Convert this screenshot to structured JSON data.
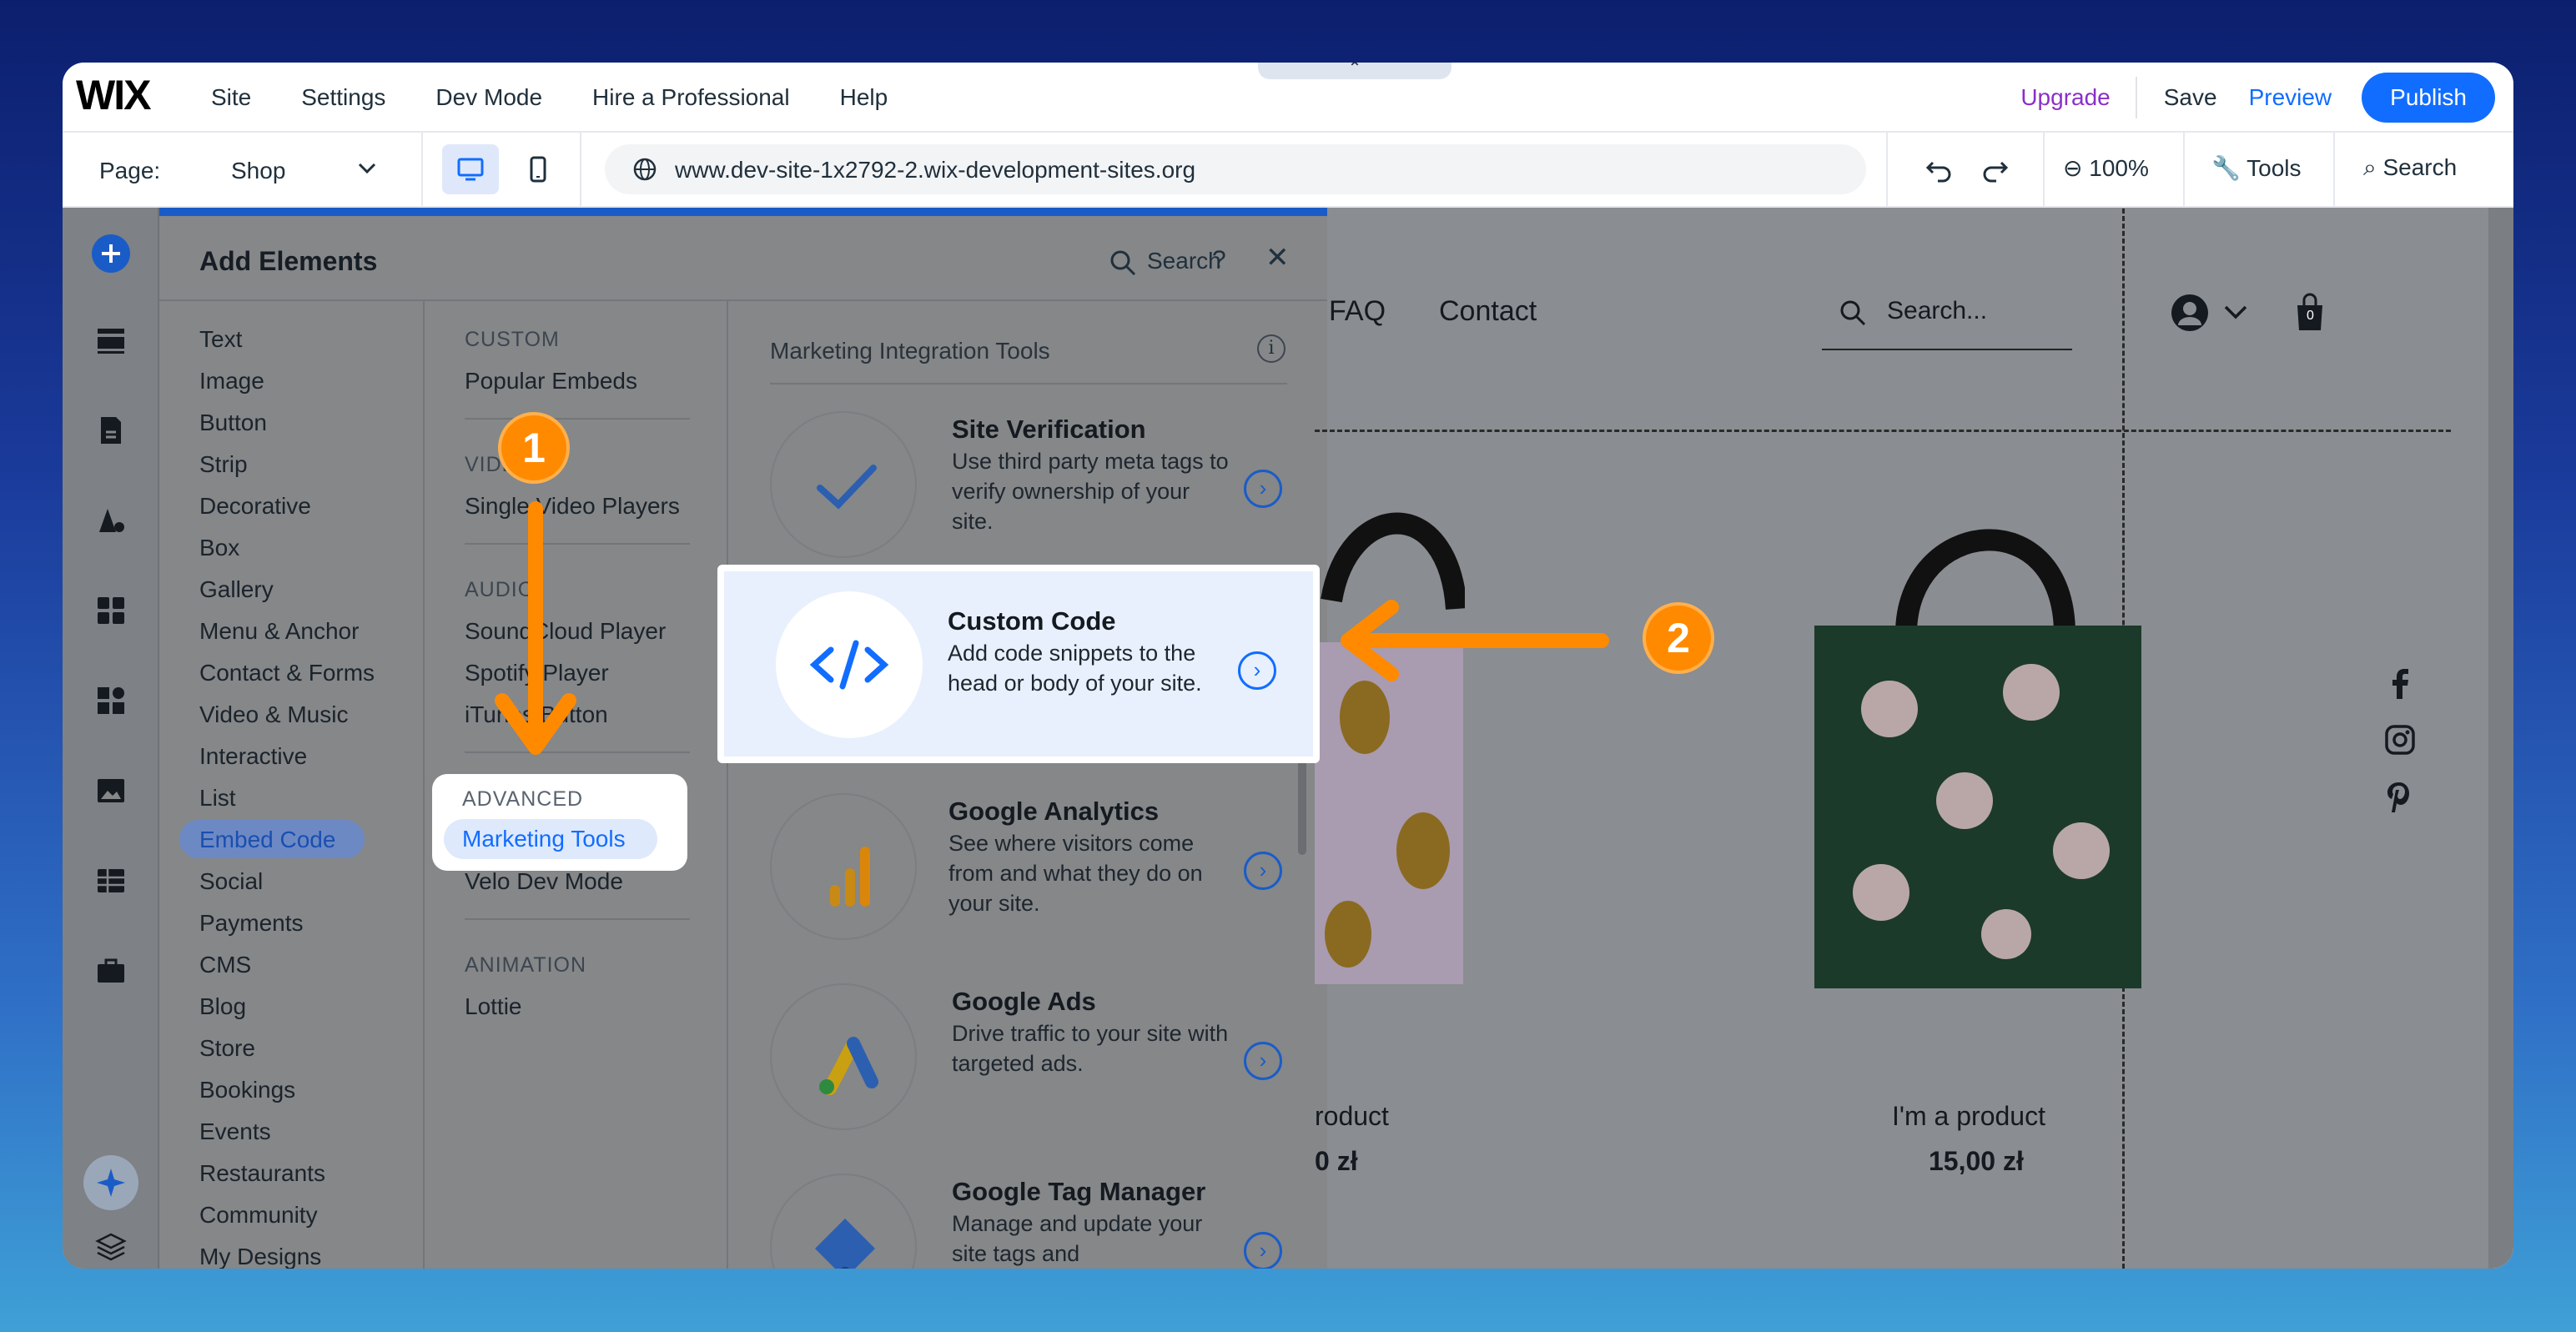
{
  "app": {
    "logo": "WIX"
  },
  "menu": [
    "Site",
    "Settings",
    "Dev Mode",
    "Hire a Professional",
    "Help"
  ],
  "topbar_right": {
    "upgrade": "Upgrade",
    "save": "Save",
    "preview": "Preview",
    "publish": "Publish"
  },
  "urlbar": {
    "page_label": "Page:",
    "page_value": "Shop",
    "url": "www.dev-site-1x2792-2.wix-development-sites.org",
    "zoom": "100%",
    "tools": "Tools",
    "search": "Search"
  },
  "panel": {
    "title": "Add Elements",
    "search": "Search",
    "help": "?",
    "categories": [
      "Text",
      "Image",
      "Button",
      "Strip",
      "Decorative",
      "Box",
      "Gallery",
      "Menu & Anchor",
      "Contact & Forms",
      "Video & Music",
      "Interactive",
      "List",
      "Embed Code",
      "Social",
      "Payments",
      "CMS",
      "Blog",
      "Store",
      "Bookings",
      "Events",
      "Restaurants",
      "Community",
      "My Designs"
    ],
    "selected_category": "Embed Code",
    "subsections": {
      "custom_header": "CUSTOM",
      "custom_item": "Popular Embeds",
      "video_header": "VIDEO",
      "video_item": "Single Video Players",
      "audio_header": "AUDIO",
      "audio_items": [
        "SoundCloud Player",
        "Spotify Player",
        "iTunes Button"
      ],
      "advanced_header": "ADVANCED",
      "advanced_items": [
        "Marketing Tools",
        "Velo Dev Mode"
      ],
      "animation_header": "ANIMATION",
      "animation_item": "Lottie"
    },
    "tools_header": "Marketing Integration Tools",
    "tools": [
      {
        "title": "Site Verification",
        "desc": "Use third party meta tags to verify ownership of your site."
      },
      {
        "title": "Custom Code",
        "desc": "Add code snippets to the head or body of your site."
      },
      {
        "title": "Google Analytics",
        "desc": "See where visitors come from and what they do on your site."
      },
      {
        "title": "Google Ads",
        "desc": "Drive traffic to your site with targeted ads."
      },
      {
        "title": "Google Tag Manager",
        "desc": "Manage and update your site tags and"
      }
    ]
  },
  "site": {
    "nav": [
      "FAQ",
      "Contact"
    ],
    "search_placeholder": "Search...",
    "cart_count": "0",
    "products": [
      {
        "name": "roduct",
        "price": "0 zł"
      },
      {
        "name": "I'm a product",
        "price": "15,00 zł"
      }
    ]
  },
  "annotations": {
    "step1": "1",
    "step2": "2",
    "accent": "#ff8a00"
  }
}
